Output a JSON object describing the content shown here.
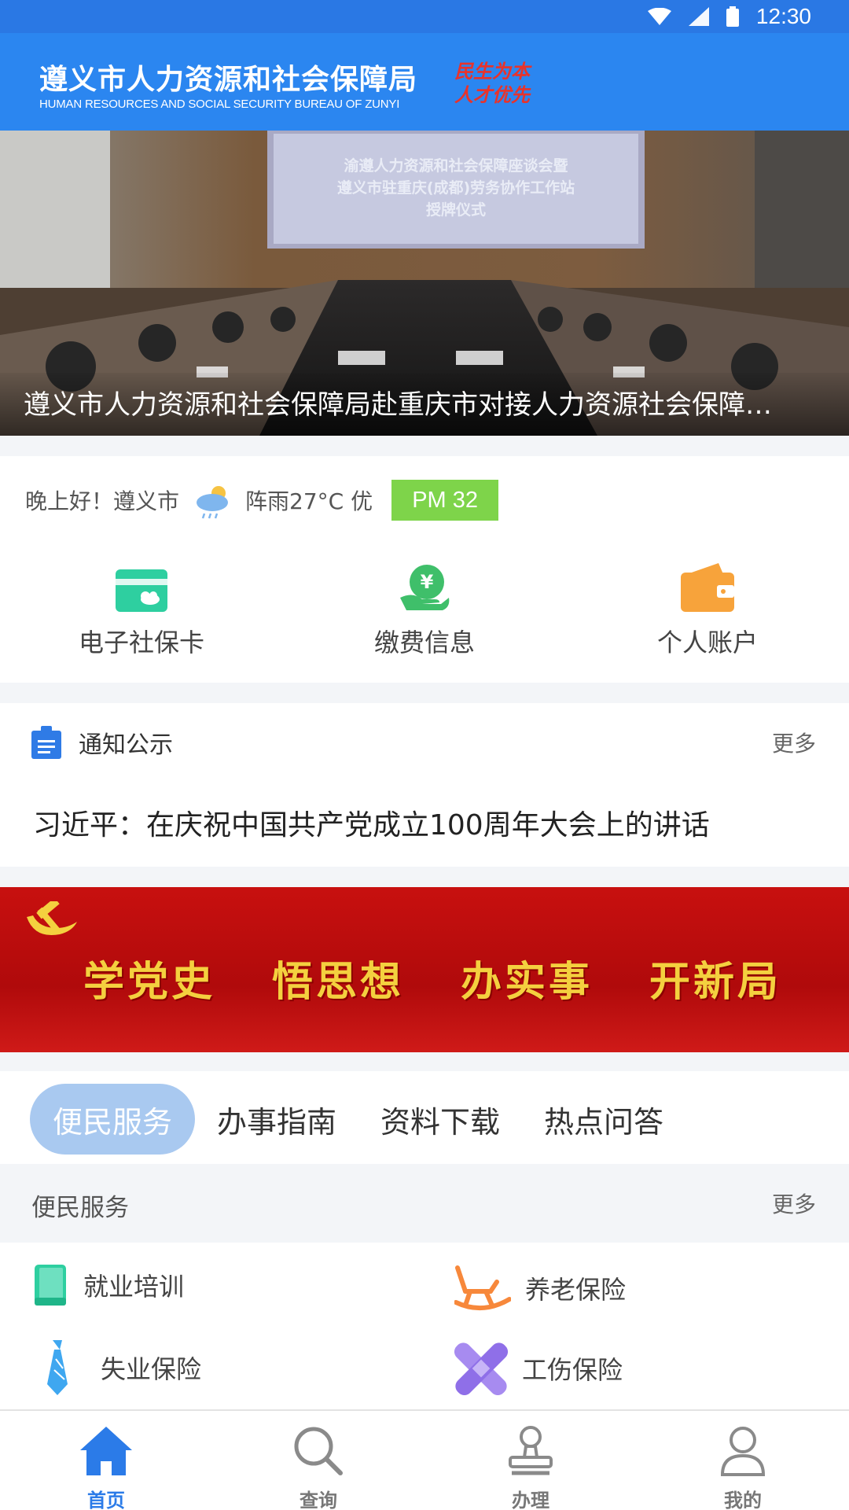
{
  "status_bar": {
    "time": "12:30"
  },
  "header": {
    "title_cn": "遵义市人力资源和社会保障局",
    "title_en": "HUMAN RESOURCES AND SOCIAL SECURITY BUREAU OF ZUNYI",
    "motto_line1": "民生为本",
    "motto_line2": "人才优先"
  },
  "banner": {
    "screen_line1": "渝遵人力资源和社会保障座谈会暨",
    "screen_line2": "遵义市驻重庆(成都)劳务协作工作站",
    "screen_line3": "授牌仪式",
    "caption": "遵义市人力资源和社会保障局赴重庆市对接人力资源社会保障…"
  },
  "greeting": {
    "text": "晚上好！遵义市",
    "weather": "阵雨27°C 优",
    "pm": "PM 32"
  },
  "quick_actions": [
    {
      "label": "电子社保卡",
      "icon": "social-security-card-icon",
      "color": "#2ecfa0"
    },
    {
      "label": "缴费信息",
      "icon": "payment-info-icon",
      "color": "#3fbf6a"
    },
    {
      "label": "个人账户",
      "icon": "wallet-icon",
      "color": "#f7a33b"
    }
  ],
  "notice": {
    "title": "通知公示",
    "more": "更多",
    "headline": "习近平：在庆祝中国共产党成立100周年大会上的讲话"
  },
  "party_banner": {
    "words": [
      "学党史",
      "悟思想",
      "办实事",
      "开新局"
    ]
  },
  "tabs": [
    {
      "label": "便民服务",
      "active": true
    },
    {
      "label": "办事指南",
      "active": false
    },
    {
      "label": "资料下载",
      "active": false
    },
    {
      "label": "热点问答",
      "active": false
    }
  ],
  "services": {
    "title": "便民服务",
    "more": "更多",
    "items": [
      {
        "label": "就业培训",
        "icon": "book-icon"
      },
      {
        "label": "养老保险",
        "icon": "rocking-chair-icon"
      },
      {
        "label": "失业保险",
        "icon": "tie-icon"
      },
      {
        "label": "工伤保险",
        "icon": "bandage-icon"
      }
    ]
  },
  "bottom_nav": [
    {
      "label": "首页",
      "icon": "home-icon",
      "active": true
    },
    {
      "label": "查询",
      "icon": "search-icon",
      "active": false
    },
    {
      "label": "办理",
      "icon": "stamp-icon",
      "active": false
    },
    {
      "label": "我的",
      "icon": "user-icon",
      "active": false
    }
  ],
  "colors": {
    "header_blue": "#2b86f0",
    "status_blue": "#2a78e4",
    "pm_green": "#7ed44a",
    "tab_active": "#a9c9f0",
    "party_red": "#c8100f",
    "nav_active": "#2b7be8"
  }
}
